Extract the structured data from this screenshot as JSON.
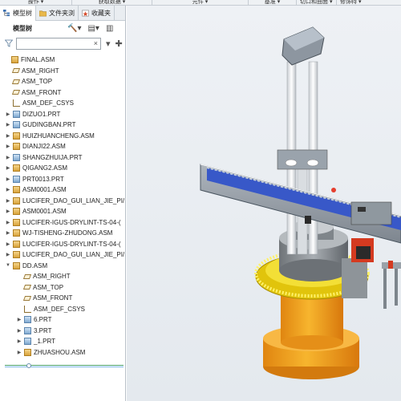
{
  "ribbon": [
    "操作 ▾",
    "获取数据 ▾",
    "元件 ▾",
    "基准 ▾",
    "切口和曲面 ▾",
    "修饰特 ▾"
  ],
  "tabs": [
    {
      "label": "模型树",
      "active": true
    },
    {
      "label": "文件夹浏",
      "active": false
    },
    {
      "label": "收藏夹",
      "active": false
    }
  ],
  "model_tree": {
    "title": "模型树",
    "search_placeholder": "",
    "items": [
      {
        "label": "FINAL.ASM",
        "icon": "assembly-icon",
        "level": 0,
        "expander": ""
      },
      {
        "label": "ASM_RIGHT",
        "icon": "datum-plane-icon",
        "level": 1,
        "expander": ""
      },
      {
        "label": "ASM_TOP",
        "icon": "datum-plane-icon",
        "level": 1,
        "expander": ""
      },
      {
        "label": "ASM_FRONT",
        "icon": "datum-plane-icon",
        "level": 1,
        "expander": ""
      },
      {
        "label": "ASM_DEF_CSYS",
        "icon": "csys-icon",
        "level": 1,
        "expander": ""
      },
      {
        "label": "DIZUO1.PRT",
        "icon": "part-icon",
        "level": 1,
        "expander": "▶"
      },
      {
        "label": "GUDINGBAN.PRT",
        "icon": "part-icon",
        "level": 1,
        "expander": "▶"
      },
      {
        "label": "HUIZHUANCHENG.ASM",
        "icon": "assembly-icon",
        "level": 1,
        "expander": "▶"
      },
      {
        "label": "DIANJI22.ASM",
        "icon": "assembly-icon",
        "level": 1,
        "expander": "▶"
      },
      {
        "label": "SHANGZHUIJA.PRT",
        "icon": "part-icon",
        "level": 1,
        "expander": "▶"
      },
      {
        "label": "QIGANG2.ASM",
        "icon": "assembly-icon",
        "level": 1,
        "expander": "▶"
      },
      {
        "label": "PRT0013.PRT",
        "icon": "part-icon",
        "level": 1,
        "expander": "▶"
      },
      {
        "label": "ASM0001.ASM",
        "icon": "assembly-icon",
        "level": 1,
        "expander": "▶"
      },
      {
        "label": "LUCIFER_DAO_GUI_LIAN_JIE_PI/",
        "icon": "assembly-icon",
        "level": 1,
        "expander": "▶"
      },
      {
        "label": "ASM0001.ASM",
        "icon": "assembly-icon",
        "level": 1,
        "expander": "▶"
      },
      {
        "label": "LUCIFER-IGUS-DRYLINT-TS-04-(",
        "icon": "assembly-icon",
        "level": 1,
        "expander": "▶"
      },
      {
        "label": "WJ-TISHENG-ZHUDONG.ASM",
        "icon": "assembly-icon",
        "level": 1,
        "expander": "▶"
      },
      {
        "label": "LUCIFER-IGUS-DRYLINT-TS-04-(",
        "icon": "assembly-icon",
        "level": 1,
        "expander": "▶"
      },
      {
        "label": "LUCIFER_DAO_GUI_LIAN_JIE_PI/",
        "icon": "assembly-icon",
        "level": 1,
        "expander": "▶"
      },
      {
        "label": "DD.ASM",
        "icon": "assembly-icon",
        "level": 1,
        "expander": "▼"
      },
      {
        "label": "ASM_RIGHT",
        "icon": "datum-plane-icon",
        "level": 2,
        "expander": ""
      },
      {
        "label": "ASM_TOP",
        "icon": "datum-plane-icon",
        "level": 2,
        "expander": ""
      },
      {
        "label": "ASM_FRONT",
        "icon": "datum-plane-icon",
        "level": 2,
        "expander": ""
      },
      {
        "label": "ASM_DEF_CSYS",
        "icon": "csys-icon",
        "level": 2,
        "expander": ""
      },
      {
        "label": "6.PRT",
        "icon": "part-icon",
        "level": 2,
        "expander": "▶"
      },
      {
        "label": "3.PRT",
        "icon": "part-icon",
        "level": 2,
        "expander": "▶"
      },
      {
        "label": "_1.PRT",
        "icon": "part-icon",
        "level": 2,
        "expander": "▶"
      },
      {
        "label": "ZHUASHOU.ASM",
        "icon": "assembly-icon",
        "level": 2,
        "expander": "▶"
      }
    ]
  },
  "colors": {
    "accent": "#2f5dc2",
    "motor_orange": "#f4a21c",
    "gear_yellow": "#f0d61a",
    "motor_red": "#d83a25"
  }
}
